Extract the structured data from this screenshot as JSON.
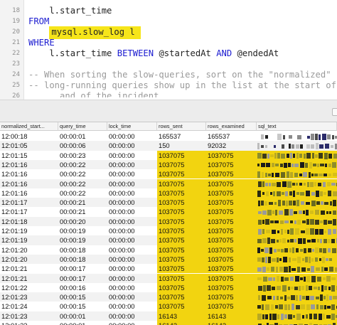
{
  "editor": {
    "lines": [
      {
        "num": "18",
        "parts": [
          {
            "t": "    l.start_time",
            "c": "plain"
          }
        ]
      },
      {
        "num": "19",
        "parts": [
          {
            "t": "FROM",
            "c": "kw"
          }
        ]
      },
      {
        "num": "20",
        "parts": [
          {
            "t": "    ",
            "c": "plain"
          },
          {
            "t": "mysql.slow_log l",
            "c": "hl"
          }
        ]
      },
      {
        "num": "21",
        "parts": [
          {
            "t": "WHERE",
            "c": "kw"
          }
        ]
      },
      {
        "num": "22",
        "parts": [
          {
            "t": "    l.start_time ",
            "c": "plain"
          },
          {
            "t": "BETWEEN",
            "c": "kw"
          },
          {
            "t": " @startedAt ",
            "c": "plain"
          },
          {
            "t": "AND",
            "c": "kw"
          },
          {
            "t": " @endedAt",
            "c": "plain"
          }
        ]
      },
      {
        "num": "23",
        "parts": []
      },
      {
        "num": "24",
        "parts": [
          {
            "t": "-- When sorting the slow-queries, sort on the \"normalized\"",
            "c": "cm"
          }
        ]
      },
      {
        "num": "25",
        "parts": [
          {
            "t": "-- long-running queries show up in the list at the start of",
            "c": "cm"
          }
        ]
      },
      {
        "num": "26",
        "parts": [
          {
            "t": "      and of the incident",
            "c": "cm"
          }
        ]
      }
    ]
  },
  "grid": {
    "columns": [
      "normalized_start...",
      "query_time",
      "lock_time",
      "rows_sent",
      "rows_examined",
      "sql_text"
    ],
    "rows": [
      {
        "start": "12:00:18",
        "query_time": "00:00:01",
        "lock_time": "00:00:00",
        "rows_sent": "165537",
        "rows_examined": "165537",
        "highlight": false
      },
      {
        "start": "12:01:05",
        "query_time": "00:00:06",
        "lock_time": "00:00:00",
        "rows_sent": "150",
        "rows_examined": "92032",
        "highlight": false
      },
      {
        "start": "12:01:15",
        "query_time": "00:00:23",
        "lock_time": "00:00:00",
        "rows_sent": "1037075",
        "rows_examined": "1037075",
        "highlight": true
      },
      {
        "start": "12:01:16",
        "query_time": "00:00:22",
        "lock_time": "00:00:00",
        "rows_sent": "1037075",
        "rows_examined": "1037075",
        "highlight": true
      },
      {
        "start": "12:01:16",
        "query_time": "00:00:22",
        "lock_time": "00:00:00",
        "rows_sent": "1037075",
        "rows_examined": "1037075",
        "highlight": true
      },
      {
        "start": "12:01:16",
        "query_time": "00:00:22",
        "lock_time": "00:00:00",
        "rows_sent": "1037075",
        "rows_examined": "1037075",
        "highlight": true
      },
      {
        "start": "12:01:16",
        "query_time": "00:00:22",
        "lock_time": "00:00:00",
        "rows_sent": "1037075",
        "rows_examined": "1037075",
        "highlight": true
      },
      {
        "start": "12:01:17",
        "query_time": "00:00:21",
        "lock_time": "00:00:00",
        "rows_sent": "1037075",
        "rows_examined": "1037075",
        "highlight": true
      },
      {
        "start": "12:01:17",
        "query_time": "00:00:21",
        "lock_time": "00:00:00",
        "rows_sent": "1037075",
        "rows_examined": "1037075",
        "highlight": true
      },
      {
        "start": "12:01:18",
        "query_time": "00:00:20",
        "lock_time": "00:00:00",
        "rows_sent": "1037075",
        "rows_examined": "1037075",
        "highlight": true
      },
      {
        "start": "12:01:19",
        "query_time": "00:00:19",
        "lock_time": "00:00:00",
        "rows_sent": "1037075",
        "rows_examined": "1037075",
        "highlight": true
      },
      {
        "start": "12:01:19",
        "query_time": "00:00:19",
        "lock_time": "00:00:00",
        "rows_sent": "1037075",
        "rows_examined": "1037075",
        "highlight": true
      },
      {
        "start": "12:01:20",
        "query_time": "00:00:18",
        "lock_time": "00:00:00",
        "rows_sent": "1037075",
        "rows_examined": "1037075",
        "highlight": true
      },
      {
        "start": "12:01:20",
        "query_time": "00:00:18",
        "lock_time": "00:00:00",
        "rows_sent": "1037075",
        "rows_examined": "1037075",
        "highlight": true
      },
      {
        "start": "12:01:21",
        "query_time": "00:00:17",
        "lock_time": "00:00:00",
        "rows_sent": "1037075",
        "rows_examined": "1037075",
        "highlight": true
      },
      {
        "start": "12:01:21",
        "query_time": "00:00:17",
        "lock_time": "00:00:00",
        "rows_sent": "1037075",
        "rows_examined": "1037075",
        "highlight": true
      },
      {
        "start": "12:01:22",
        "query_time": "00:00:16",
        "lock_time": "00:00:00",
        "rows_sent": "1037075",
        "rows_examined": "1037075",
        "highlight": true
      },
      {
        "start": "12:01:23",
        "query_time": "00:00:15",
        "lock_time": "00:00:00",
        "rows_sent": "1037075",
        "rows_examined": "1037075",
        "highlight": true
      },
      {
        "start": "12:01:24",
        "query_time": "00:00:15",
        "lock_time": "00:00:00",
        "rows_sent": "1037075",
        "rows_examined": "1037075",
        "highlight": true
      },
      {
        "start": "12:01:23",
        "query_time": "00:00:01",
        "lock_time": "00:00:00",
        "rows_sent": "16143",
        "rows_examined": "16143",
        "highlight": true
      },
      {
        "start": "12:01:23",
        "query_time": "00:00:01",
        "lock_time": "00:00:00",
        "rows_sent": "16143",
        "rows_examined": "16143",
        "highlight": true
      }
    ],
    "sql_text_state": "pixelated",
    "highlight_color": "#f2d410"
  },
  "colors": {
    "keyword": "#1b1bd0",
    "comment": "#9a9a9a",
    "editor_highlight": "#f6e51a",
    "row_stripe": "#f2f2f2"
  }
}
